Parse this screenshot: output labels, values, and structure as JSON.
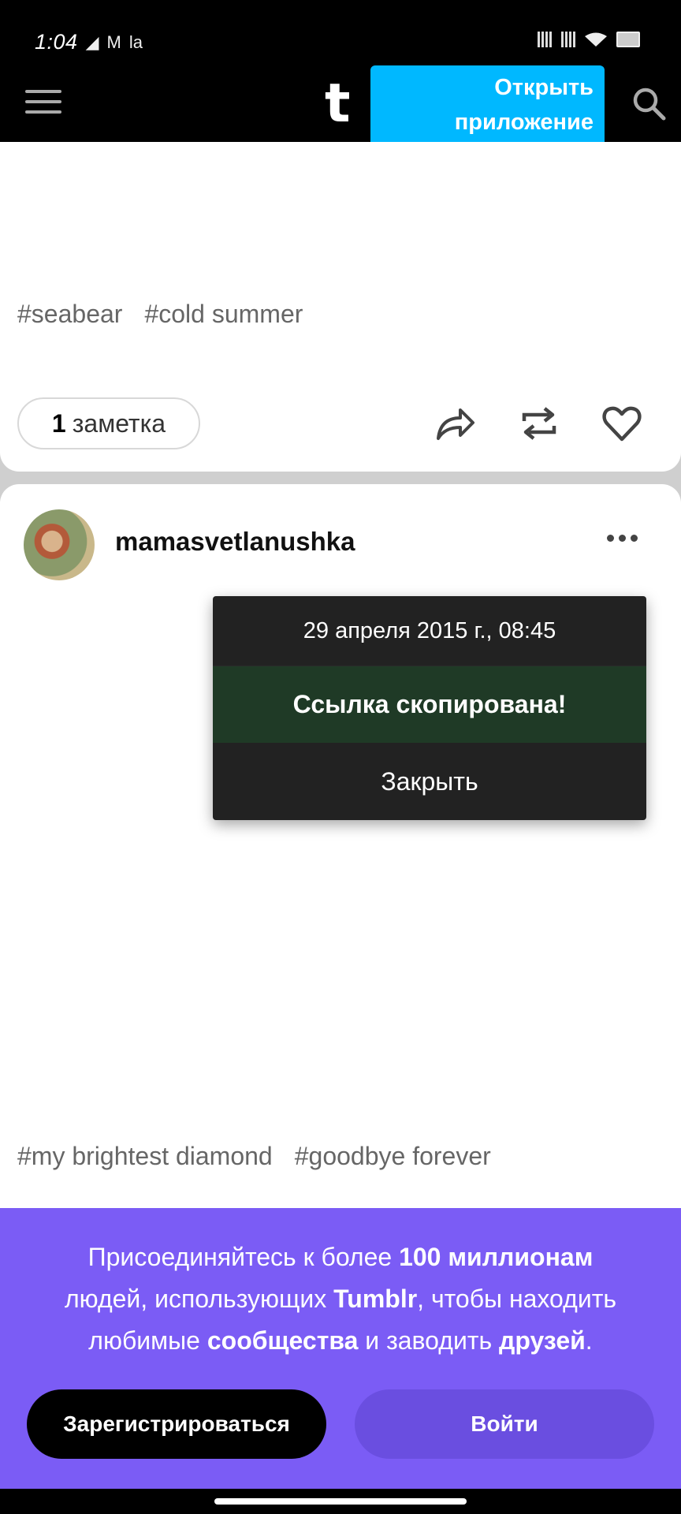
{
  "status_bar": {
    "time": "1:04",
    "icons": [
      "notification-icon",
      "gmail-icon",
      "la-icon",
      "signal-icon",
      "signal-icon",
      "wifi-icon",
      "battery-icon"
    ],
    "glyph_m": "M",
    "glyph_la": "la"
  },
  "header": {
    "logo": "t",
    "open_app_line1": "Открыть",
    "open_app_line2": "приложение",
    "accent_color": "#00b8ff"
  },
  "post1": {
    "tags": [
      "#seabear",
      "#cold summer"
    ],
    "notes_count": "1",
    "notes_label": "заметка",
    "actions": [
      "share-icon",
      "reblog-icon",
      "like-icon"
    ]
  },
  "post2": {
    "username": "mamasvetlanushka",
    "tags": [
      "#my brightest diamond",
      "#goodbye forever"
    ]
  },
  "popup": {
    "date": "29 апреля 2015 г., 08:45",
    "copied": "Ссылка скопирована!",
    "close": "Закрыть"
  },
  "signup": {
    "line1_a": "Присоединяйтесь к более ",
    "line1_b": "100 миллионам",
    "line2_a": "людей, использующих ",
    "line2_b": "Tumblr",
    "line2_c": ", чтобы находить",
    "line3_a": "любимые ",
    "line3_b": "сообщества",
    "line3_c": " и заводить ",
    "line3_d": "друзей",
    "line3_e": ".",
    "register": "Зарегистрироваться",
    "login": "Войти",
    "banner_color": "#7b5cf5"
  }
}
